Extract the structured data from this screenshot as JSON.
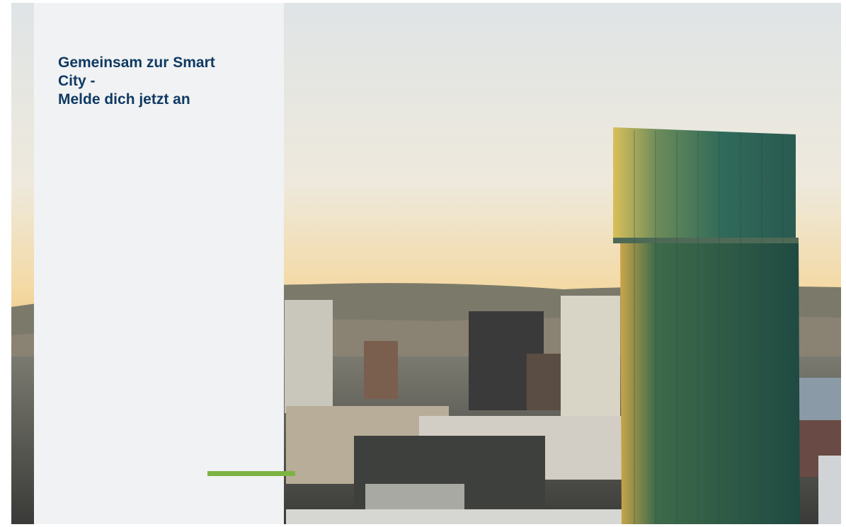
{
  "hero": {
    "headline_lines": [
      "Gemeinsam zur Smart",
      "City -",
      "Melde dich jetzt an"
    ]
  },
  "colors": {
    "headline": "#0f3a63",
    "panel": "#f1f2f3",
    "accent": "#7cb342"
  },
  "icons": {
    "photo": "city-skyline-photo"
  }
}
